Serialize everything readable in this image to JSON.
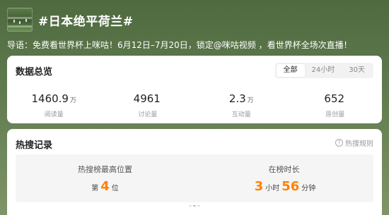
{
  "header": {
    "title": "#日本绝平荷兰#"
  },
  "guide": {
    "text": "导语：免费看世界杯上咪咕！6月12日–7月20日，锁定@咪咕视频 ，看世界杯全场次直播！"
  },
  "overview": {
    "title": "数据总览",
    "tabs": [
      {
        "label": "全部",
        "active": true
      },
      {
        "label": "24小时",
        "active": false
      },
      {
        "label": "30天",
        "active": false
      }
    ],
    "stats": [
      {
        "value": "1460.9",
        "unit": "万",
        "label": "阅读量"
      },
      {
        "value": "4961",
        "unit": "",
        "label": "讨论量"
      },
      {
        "value": "2.3",
        "unit": "万",
        "label": "互动量"
      },
      {
        "value": "652",
        "unit": "",
        "label": "原创量"
      }
    ]
  },
  "hot": {
    "title": "热搜记录",
    "rules_label": "热搜规则",
    "rules_icon": "question-circle-icon",
    "peak": {
      "label": "热搜榜最高位置",
      "prefix": "第",
      "value": "4",
      "suffix": "位"
    },
    "duration": {
      "label": "在榜时长",
      "hours": "3",
      "hours_unit": "小时",
      "minutes": "56",
      "minutes_unit": "分钟"
    }
  },
  "colors": {
    "accent": "#ff8200"
  }
}
